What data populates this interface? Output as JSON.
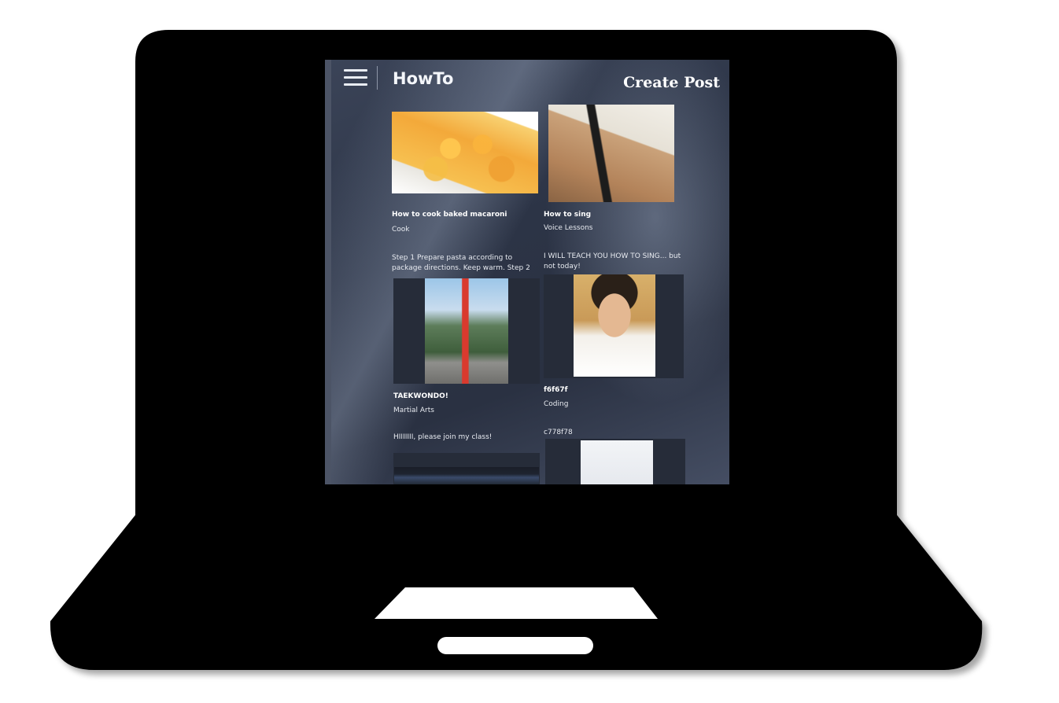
{
  "app": {
    "brand": "HowTo",
    "create_post_label": "Create Post",
    "menu_icon": "hamburger-icon"
  },
  "posts": [
    {
      "title": "How to cook baked macaroni",
      "category": "Cook",
      "description": "Step 1 Prepare pasta according to package directions. Keep warm. Step 2"
    },
    {
      "title": "How to sing",
      "category": "Voice Lessons",
      "description": "I WILL TEACH YOU HOW TO SING... but not today!"
    },
    {
      "title": "TAEKWONDO!",
      "category": "Martial Arts",
      "description": "HIIIIIII, please join my class!"
    },
    {
      "title": "f6f67f",
      "category": "Coding",
      "description": "c778f78"
    }
  ]
}
